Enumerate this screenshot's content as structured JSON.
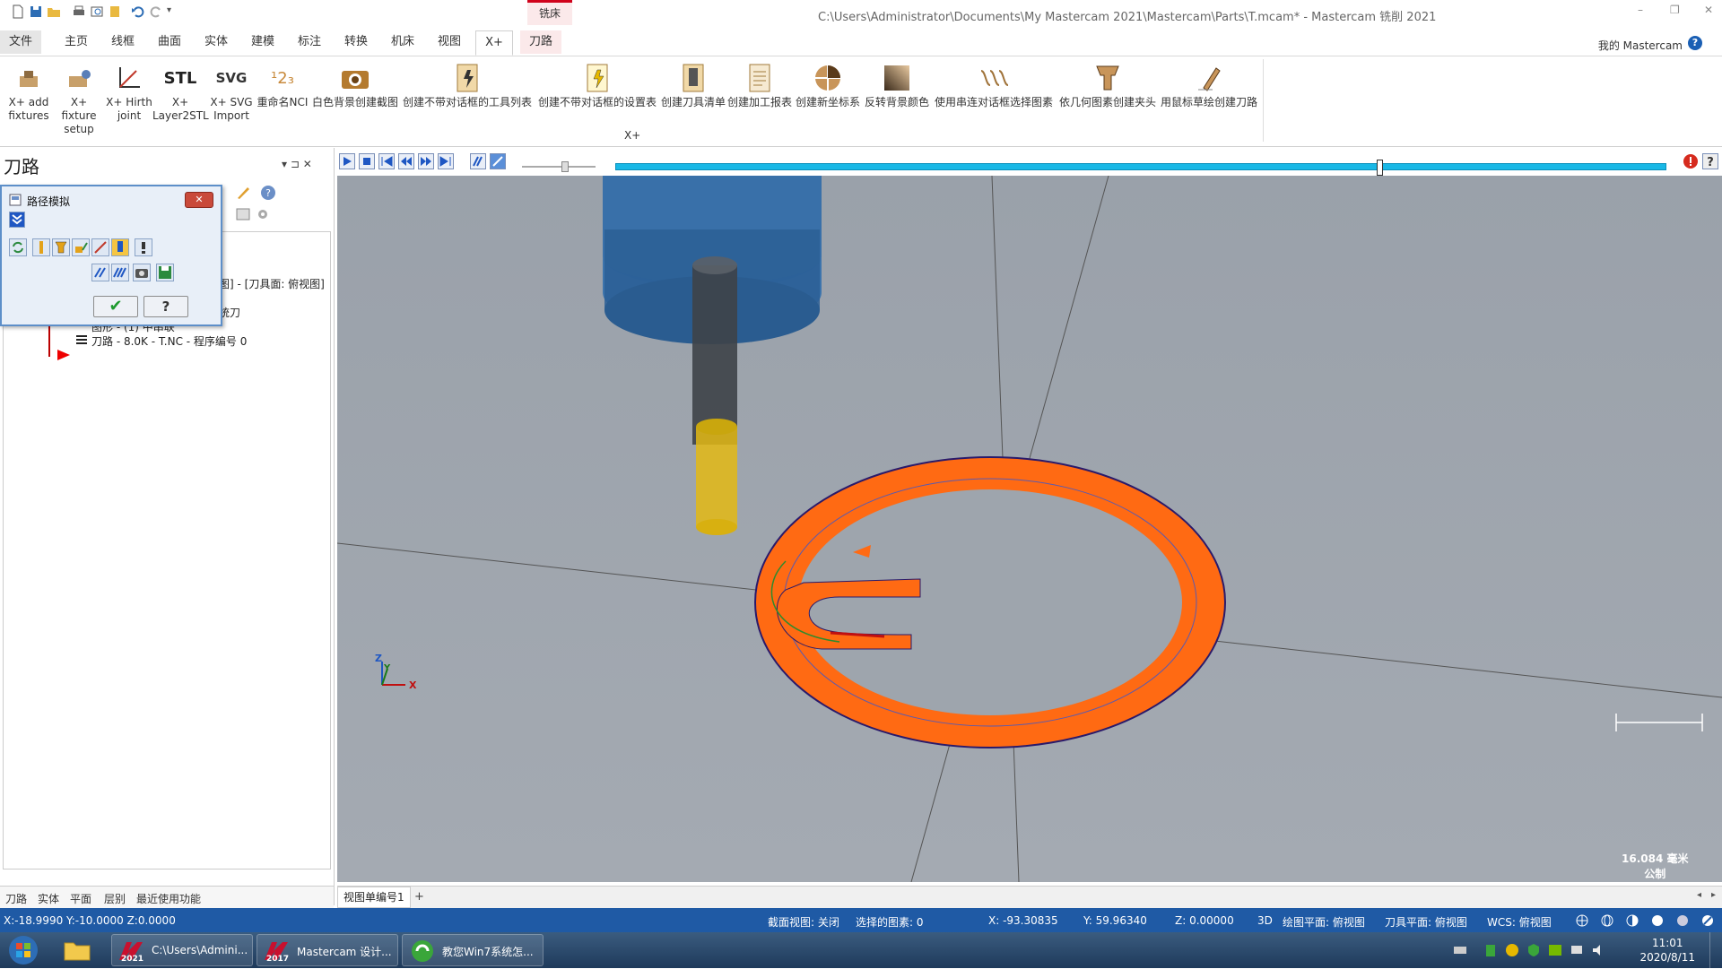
{
  "window": {
    "title": "C:\\Users\\Administrator\\Documents\\My Mastercam 2021\\Mastercam\\Parts\\T.mcam* - Mastercam 铣削 2021",
    "context_tab_label": "铣床",
    "minimize": "–",
    "restore": "❐",
    "close": "✕"
  },
  "menu": {
    "tabs": [
      "文件",
      "主页",
      "线框",
      "曲面",
      "实体",
      "建模",
      "标注",
      "转换",
      "机床",
      "视图",
      "X+",
      "刀路"
    ],
    "active": "X+",
    "account": "我的 Mastercam",
    "help": "?"
  },
  "ribbon": {
    "group_label": "X+",
    "buttons": [
      {
        "label1": "X+ add",
        "label2": "fixtures",
        "icon": "fixture-icon"
      },
      {
        "label1": "X+ fixture",
        "label2": "setup",
        "icon": "fixture-setup-icon"
      },
      {
        "label1": "X+ Hirth",
        "label2": "joint",
        "icon": "axis-icon"
      },
      {
        "label1": "X+",
        "label2": "Layer2STL",
        "icon": "stl-icon",
        "text": "STL"
      },
      {
        "label1": "X+ SVG",
        "label2": "Import",
        "icon": "svg-icon",
        "text": "SVG"
      },
      {
        "label1": "重命名NCI",
        "label2": "",
        "icon": "rename-icon",
        "text": "¹2₃"
      },
      {
        "label1": "白色背景创建截图",
        "label2": "",
        "icon": "camera-icon"
      },
      {
        "label1": "创建不带对话框的工具列表",
        "label2": "",
        "icon": "tool-list-icon"
      },
      {
        "label1": "创建不带对话框的设置表",
        "label2": "",
        "icon": "setup-sheet-icon"
      },
      {
        "label1": "创建刀具清单",
        "label2": "",
        "icon": "tool-inventory-icon"
      },
      {
        "label1": "创建加工报表",
        "label2": "",
        "icon": "report-icon"
      },
      {
        "label1": "创建新坐标系",
        "label2": "",
        "icon": "coordinate-icon"
      },
      {
        "label1": "反转背景颜色",
        "label2": "",
        "icon": "invert-color-icon"
      },
      {
        "label1": "使用串连对话框选择图素",
        "label2": "",
        "icon": "chain-icon"
      },
      {
        "label1": "依几何图素创建夹头",
        "label2": "",
        "icon": "holder-icon"
      },
      {
        "label1": "用鼠标草绘创建刀路",
        "label2": "",
        "icon": "sketch-icon"
      }
    ]
  },
  "left_panel": {
    "title": "刀路",
    "pin": "▾  ⊐  ✕",
    "tree": [
      "图] - [刀具面: 俯视图]",
      "统刀",
      "图形 - (1) 中串联",
      "刀路 - 8.0K - T.NC - 程序编号 0"
    ],
    "bottom_tabs": [
      "刀路",
      "实体",
      "平面",
      "层别",
      "最近使用功能"
    ]
  },
  "sim_dialog": {
    "title": "路径模拟",
    "ok": "✔",
    "help": "?",
    "close": "✕"
  },
  "viewport": {
    "tab": "视图单编号1",
    "add_tab": "+",
    "scale_value": "16.084 毫米",
    "scale_unit": "公制",
    "axis_x": "X",
    "axis_y": "Y",
    "axis_z": "Z"
  },
  "status": {
    "coords_left": "X:-18.9990   Y:-10.0000   Z:0.0000",
    "section_view": "截面视图: 关闭",
    "selected": "选择的图素: 0",
    "x": "X:   -93.30835",
    "y": "Y:   59.96340",
    "z": "Z:   0.00000",
    "mode": "3D",
    "draw_plane": "绘图平面: 俯视图",
    "tool_plane": "刀具平面: 俯视图",
    "wcs": "WCS: 俯视图"
  },
  "taskbar": {
    "items": [
      {
        "label": "C:\\Users\\Admini...",
        "year": "2021"
      },
      {
        "label": "Mastercam 设计...",
        "year": "2017"
      },
      {
        "label": "教您Win7系统怎..."
      }
    ],
    "time": "11:01",
    "date": "2020/8/11"
  },
  "colors": {
    "status_bar": "#1f5aa5",
    "progress": "#19b8e6",
    "part_orange": "#ff6a13",
    "tool_blue": "#2c5f93"
  }
}
